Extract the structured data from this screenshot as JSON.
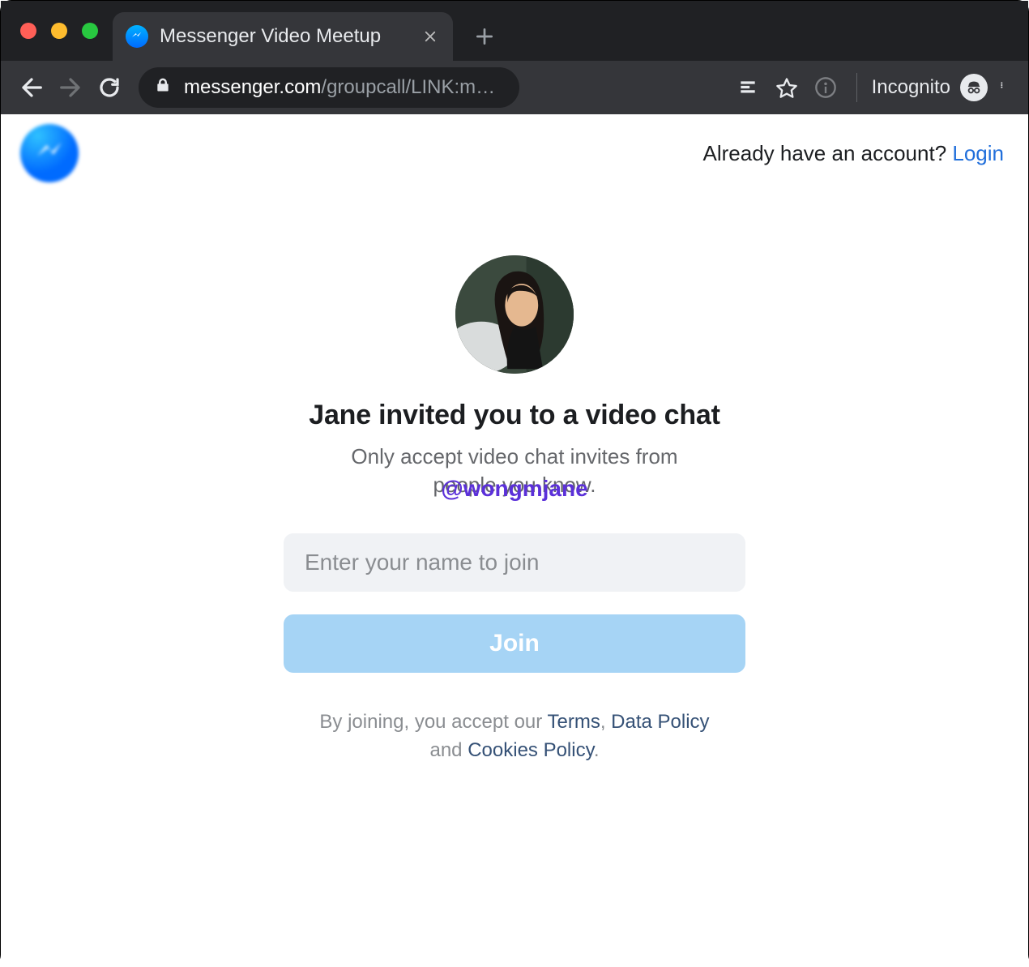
{
  "browser": {
    "tab_title": "Messenger Video Meetup",
    "url_domain": "messenger.com",
    "url_path": "/groupcall/LINK:m…",
    "incognito_label": "Incognito"
  },
  "header": {
    "prompt": "Already have an account? ",
    "login_label": "Login"
  },
  "invite": {
    "heading": "Jane invited you to a video chat",
    "subtext_line1": "Only accept video chat invites from",
    "subtext_line2": "people you know.",
    "watermark": "@wongmjane",
    "input_placeholder": "Enter your name to join",
    "join_label": "Join"
  },
  "legal": {
    "prefix": "By joining, you accept our ",
    "terms": "Terms",
    "sep1": ", ",
    "data_policy": "Data Policy",
    "sep2": " and ",
    "cookies": "Cookies Policy",
    "suffix": "."
  }
}
